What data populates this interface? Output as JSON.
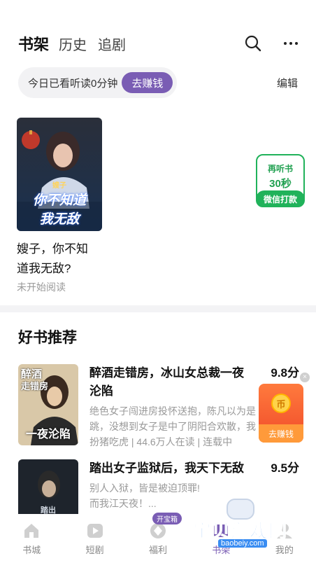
{
  "header": {
    "tabs": [
      {
        "label": "书架",
        "active": true
      },
      {
        "label": "历史",
        "active": false
      },
      {
        "label": "追剧",
        "active": false
      }
    ],
    "icons": [
      "search-icon",
      "more-icon"
    ]
  },
  "reading": {
    "today_text": "今日已看听读0分钟",
    "earn_label": "去赚钱",
    "edit_label": "编辑"
  },
  "shelf": {
    "book": {
      "cover_text_top": "嫂子",
      "cover_text_line1": "你不知道",
      "cover_text_line2": "我无敌",
      "title_line1": "嫂子，你不知",
      "title_line2": "道我无敌?",
      "status": "未开始阅读"
    },
    "listen": {
      "line1": "再听书",
      "line2": "30秒",
      "cta": "微信打款"
    }
  },
  "recommend": {
    "section_title": "好书推荐",
    "items": [
      {
        "title": "醉酒走错房，冰山女总裁一夜沦陷",
        "score": "9.8分",
        "desc1": "绝色女子闯进房投怀送抱，陈凡以为是",
        "desc2": "跳，没想到女子是中了阴阳合欢散，我",
        "meta": "扮猪吃虎 | 44.6万人在读 | 连载中",
        "cover_lines": [
          "醉酒",
          "走错房",
          "一夜沦陷"
        ]
      },
      {
        "title": "踏出女子监狱后，我天下无敌",
        "score": "9.5分",
        "desc1": "别人入狱，皆是被迫顶罪!",
        "desc2": "而我江天夜！...",
        "cover_lines": [
          "踏出"
        ]
      }
    ]
  },
  "float_widget": {
    "coin_char": "币",
    "label": "去赚钱",
    "close_char": "×"
  },
  "bottom_nav": {
    "items": [
      {
        "label": "书城",
        "icon": "home-icon"
      },
      {
        "label": "短剧",
        "icon": "play-icon"
      },
      {
        "label": "福利",
        "icon": "gift-icon",
        "badge": "开宝箱"
      },
      {
        "label": "书架",
        "icon": "bookshelf-icon",
        "active": true
      },
      {
        "label": "我的",
        "icon": "profile-icon"
      }
    ]
  },
  "watermark": {
    "big": "宝贝游戏网",
    "small": "baobeiy.com"
  },
  "colors": {
    "accent": "#7a5db4",
    "green": "#20b25a",
    "orange": "#f04b2a"
  }
}
